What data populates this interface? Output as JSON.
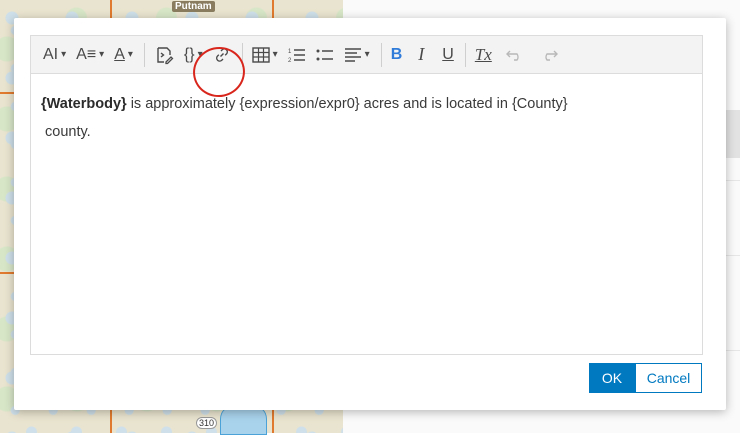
{
  "map": {
    "place_label": "Putnam",
    "road_number": "310"
  },
  "toolbar": {
    "font_size_icon": "AI",
    "heading_icon": "A≡",
    "font_color_icon": "A",
    "expression_icon": "insert-expression",
    "field_icon": "{}",
    "bold": "B",
    "italic": "I",
    "underline": "U",
    "clear_format": "Tx"
  },
  "editor": {
    "line1": {
      "field": "{Waterbody}",
      "text1": " is approximately ",
      "expression": "{expression/expr0}",
      "text2": " acres and is located in ",
      "county_field": "{County}"
    },
    "line2": "county."
  },
  "buttons": {
    "ok": "OK",
    "cancel": "Cancel"
  },
  "colors": {
    "accent": "#0079c1",
    "bold_active": "#2f7bd9",
    "annotation": "#d9261c"
  }
}
